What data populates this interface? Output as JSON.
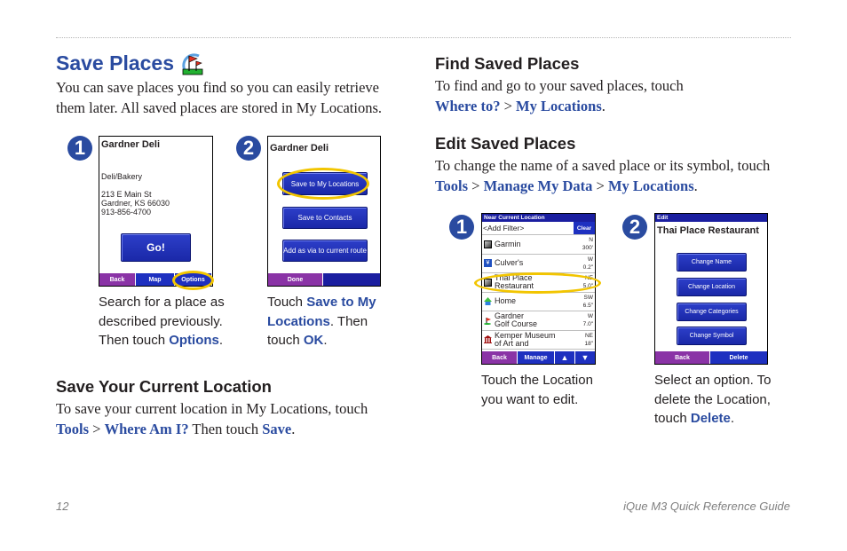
{
  "page": {
    "title": "Save Places",
    "title_icon": "golf-flag-icon",
    "intro": "You can save places you find so you can easily retrieve them later. All saved places are stored in My Locations."
  },
  "save_steps": [
    {
      "number": "1",
      "screen": {
        "title": "Gardner Deli",
        "category": "Deli/Bakery",
        "address_line1": "213 E Main St",
        "address_line2": "Gardner, KS 66030",
        "phone": "913-856-4700",
        "go_button": "Go!",
        "tabs": [
          "Back",
          "Map",
          "Options"
        ]
      },
      "caption": {
        "before": "Search for a place as described previously. Then touch ",
        "link": "Options",
        "after": "."
      }
    },
    {
      "number": "2",
      "screen": {
        "title": "Gardner Deli",
        "buttons": [
          "Save to My Locations",
          "Save to Contacts",
          "Add as via to current route"
        ],
        "tabs": [
          "Done"
        ]
      },
      "caption": {
        "before": "Touch ",
        "link1": "Save to My Locations",
        "middle": ". Then touch ",
        "link2": "OK",
        "after": "."
      }
    }
  ],
  "save_current": {
    "heading": "Save Your Current Location",
    "text": "To save your current location in My Locations, touch",
    "link1": "Tools",
    "sep": " > ",
    "link2": "Where Am I?",
    "middle": " Then touch ",
    "link3": "Save",
    "after": "."
  },
  "find_saved": {
    "heading": "Find Saved Places",
    "text": "To find and go to your saved places, touch",
    "link1": "Where to?",
    "sep": " > ",
    "link2": "My Locations",
    "after": "."
  },
  "edit_saved": {
    "heading": "Edit Saved Places",
    "text": "To change the name of a saved place or its symbol, touch",
    "link1": "Tools",
    "sep1": " > ",
    "link2": "Manage My Data",
    "sep2": " > ",
    "link3": "My Locations",
    "after": "."
  },
  "edit_steps": [
    {
      "number": "1",
      "screen": {
        "header": "Near Current Location",
        "filter": "<Add Filter>",
        "clear": "Clear",
        "rows": [
          {
            "name1": "Garmin",
            "name2": "",
            "dir": "N",
            "dist": "300'",
            "icon": "square-icon"
          },
          {
            "name1": "Culver's",
            "name2": "",
            "dir": "W",
            "dist": "0.2\"",
            "icon": "restaurant-icon"
          },
          {
            "name1": "Thai Place",
            "name2": "Restaurant",
            "dir": "NE",
            "dist": "5.0\"",
            "icon": "square-icon"
          },
          {
            "name1": "Home",
            "name2": "",
            "dir": "SW",
            "dist": "6.5\"",
            "icon": "home-icon"
          },
          {
            "name1": "Gardner",
            "name2": "Golf Course",
            "dir": "W",
            "dist": "7.0\"",
            "icon": "golf-icon"
          },
          {
            "name1": "Kemper Museum",
            "name2": "of Art and",
            "dir": "NE",
            "dist": "18\"",
            "icon": "museum-icon"
          }
        ],
        "tabs": [
          "Back",
          "Manage"
        ]
      },
      "caption": "Touch the Location you want to edit."
    },
    {
      "number": "2",
      "screen": {
        "header": "Edit",
        "title": "Thai Place Restaurant",
        "buttons": [
          "Change Name",
          "Change Location",
          "Change Categories",
          "Change Symbol"
        ],
        "tabs": [
          "Back",
          "Delete"
        ]
      },
      "caption": {
        "before": "Select an option. To delete the Location, touch ",
        "link": "Delete",
        "after": "."
      }
    }
  ],
  "footer": {
    "page_number": "12",
    "guide_title": "iQue M3 Quick Reference Guide"
  },
  "colors": {
    "accent_blue": "#2a4ba0",
    "highlight_yellow": "#f2c500",
    "device_button": "#1a28a8",
    "device_tab_purple": "#8a33a6"
  }
}
